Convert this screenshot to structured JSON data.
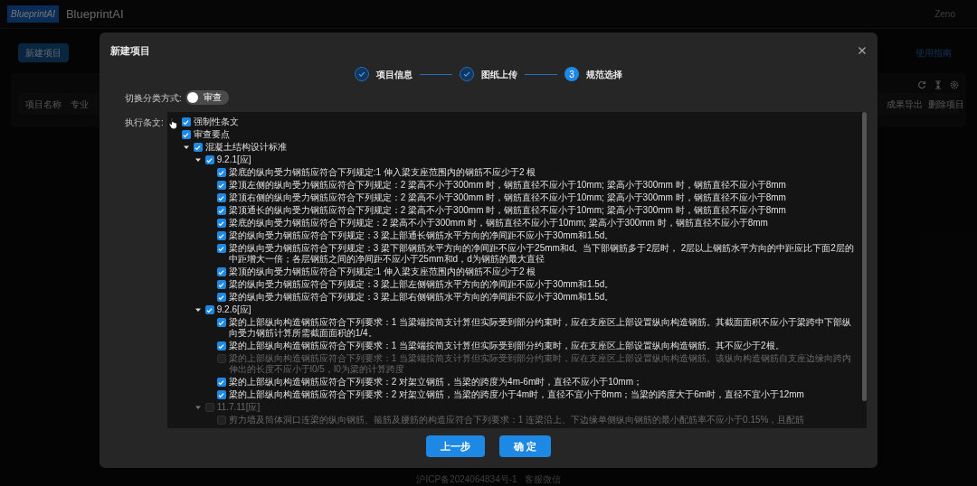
{
  "header": {
    "logo": "BlueprintAI",
    "app_name": "BlueprintAI",
    "user": "Zeno"
  },
  "toolbar": {
    "new_button": "新建项目",
    "guide_link": "使用指南"
  },
  "table": {
    "columns": [
      "项目名称",
      "专业",
      "成果导出",
      "删除项目"
    ]
  },
  "dialog": {
    "title": "新建项目",
    "steps": [
      {
        "label": "项目信息",
        "done": true
      },
      {
        "label": "图纸上传",
        "done": true
      },
      {
        "label": "规范选择",
        "done": false,
        "number": "3"
      }
    ],
    "toggle": {
      "label": "切换分类方式:",
      "text": "审查",
      "on": false
    },
    "tree_label": "执行条文:",
    "tree": [
      {
        "label": "强制性条文",
        "checked": true,
        "disabled": false
      },
      {
        "label": "审查要点",
        "checked": true,
        "disabled": false
      },
      {
        "label": "混凝土结构设计标准",
        "checked": true,
        "disabled": false,
        "expanded": true,
        "children": [
          {
            "label": "9.2.1[应]",
            "checked": true,
            "disabled": false,
            "expanded": true,
            "children": [
              {
                "label": "梁底的纵向受力钢筋应符合下列规定:1 伸入梁支座范围内的钢筋不应少于2 根",
                "checked": true,
                "disabled": false
              },
              {
                "label": "梁顶左侧的纵向受力钢筋应符合下列规定：2 梁高不小于300mm 时，钢筋直径不应小于10mm; 梁高小于300mm 时，钢筋直径不应小于8mm",
                "checked": true,
                "disabled": false
              },
              {
                "label": "梁顶右侧的纵向受力钢筋应符合下列规定：2 梁高不小于300mm 时，钢筋直径不应小于10mm; 梁高小于300mm 时，钢筋直径不应小于8mm",
                "checked": true,
                "disabled": false
              },
              {
                "label": "梁顶通长的纵向受力钢筋应符合下列规定：2 梁高不小于300mm 时，钢筋直径不应小于10mm; 梁高小于300mm 时，钢筋直径不应小于8mm",
                "checked": true,
                "disabled": false
              },
              {
                "label": "梁底的纵向受力钢筋应符合下列规定：2 梁高不小于300mm 时，钢筋直径不应小于10mm; 梁高小于300mm 时，钢筋直径不应小于8mm",
                "checked": true,
                "disabled": false
              },
              {
                "label": "梁的纵向受力钢筋应符合下列规定：3 梁上部通长钢筋水平方向的净间距不应小于30mm和1.5d。",
                "checked": true,
                "disabled": false
              },
              {
                "label": "梁的纵向受力钢筋应符合下列规定：3 梁下部钢筋水平方向的净间距不应小于25mm和d。当下部钢筋多于2层时， 2层以上钢筋水平方向的中距应比下面2层的中距增大一倍；各层钢筋之间的净间距不应小于25mm和d，d为钢筋的最大直径",
                "checked": true,
                "disabled": false
              },
              {
                "label": "梁顶的纵向受力钢筋应符合下列规定:1 伸入梁支座范围内的钢筋不应少于2 根",
                "checked": true,
                "disabled": false
              },
              {
                "label": "梁的纵向受力钢筋应符合下列规定：3 梁上部左侧钢筋水平方向的净间距不应小于30mm和1.5d。",
                "checked": true,
                "disabled": false
              },
              {
                "label": "梁的纵向受力钢筋应符合下列规定：3 梁上部右侧钢筋水平方向的净间距不应小于30mm和1.5d。",
                "checked": true,
                "disabled": false
              }
            ]
          },
          {
            "label": "9.2.6[应]",
            "checked": true,
            "disabled": false,
            "expanded": true,
            "children": [
              {
                "label": "梁的上部纵向构造钢筋应符合下列要求：1 当梁端按简支计算但实际受到部分约束时，应在支座区上部设置纵向构造钢筋。其截面面积不应小于梁跨中下部纵向受力钢筋计算所需截面面积的1/4。",
                "checked": true,
                "disabled": false
              },
              {
                "label": "梁的上部纵向构造钢筋应符合下列要求：1 当梁端按简支计算但实际受到部分约束时，应在支座区上部设置纵向构造钢筋。其不应少于2根。",
                "checked": true,
                "disabled": false
              },
              {
                "label": "梁的上部纵向构造钢筋应符合下列要求：1 当梁端按简支计算但实际受到部分约束时，应在支座区上部设置纵向构造钢筋。该纵向构造钢筋自支座边缘向跨内伸出的长度不应小于l0/5，l0为梁的计算跨度",
                "checked": false,
                "disabled": true
              },
              {
                "label": "梁的上部纵向构造钢筋应符合下列要求：2 对架立钢筋，当梁的跨度为4m-6m时，直径不应小于10mm；",
                "checked": true,
                "disabled": false
              },
              {
                "label": "梁的上部纵向构造钢筋应符合下列要求：2 对架立钢筋，当梁的跨度小于4m时，直径不宜小于8mm；当梁的跨度大于6m时，直径不宜小于12mm",
                "checked": true,
                "disabled": false
              }
            ]
          },
          {
            "label": "11.7.11[应]",
            "checked": false,
            "disabled": true,
            "expanded": true,
            "children": [
              {
                "label": "剪力墙及筒体洞口连梁的纵向钢筋、箍筋及腰筋的构造应符合下列要求：1 连梁沿上、下边缘单侧纵向钢筋的最小配筋率不应小于0.15%，且配筋",
                "checked": false,
                "disabled": true
              }
            ]
          }
        ]
      }
    ],
    "buttons": [
      "上一步",
      "确 定"
    ]
  },
  "footer": {
    "icp": "沪ICP备2024064834号-1",
    "service": "客服微信"
  }
}
